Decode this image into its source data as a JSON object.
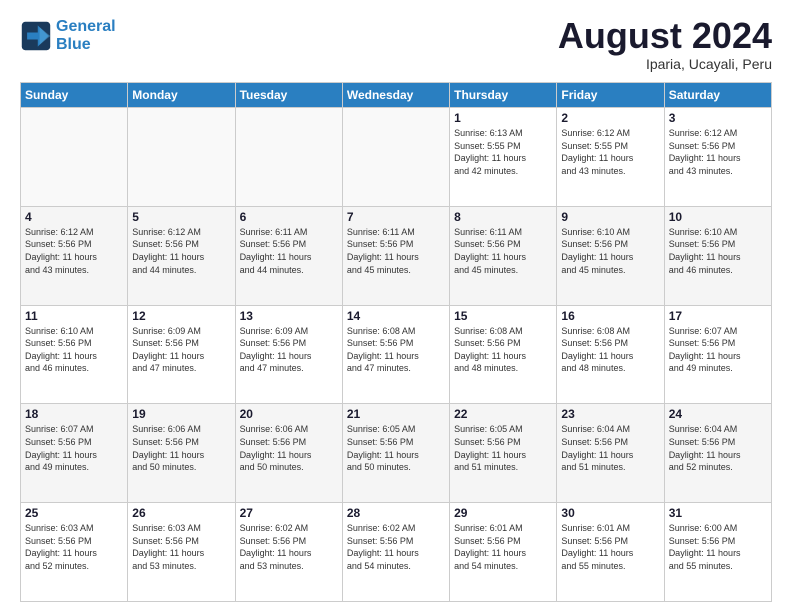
{
  "logo": {
    "line1": "General",
    "line2": "Blue"
  },
  "title": "August 2024",
  "subtitle": "Iparia, Ucayali, Peru",
  "weekdays": [
    "Sunday",
    "Monday",
    "Tuesday",
    "Wednesday",
    "Thursday",
    "Friday",
    "Saturday"
  ],
  "weeks": [
    [
      {
        "day": "",
        "empty": true
      },
      {
        "day": "",
        "empty": true
      },
      {
        "day": "",
        "empty": true
      },
      {
        "day": "",
        "empty": true
      },
      {
        "day": "1",
        "sunrise": "6:13 AM",
        "sunset": "5:55 PM",
        "daylight": "11 hours and 42 minutes."
      },
      {
        "day": "2",
        "sunrise": "6:12 AM",
        "sunset": "5:55 PM",
        "daylight": "11 hours and 43 minutes."
      },
      {
        "day": "3",
        "sunrise": "6:12 AM",
        "sunset": "5:56 PM",
        "daylight": "11 hours and 43 minutes."
      }
    ],
    [
      {
        "day": "4",
        "sunrise": "6:12 AM",
        "sunset": "5:56 PM",
        "daylight": "11 hours and 43 minutes."
      },
      {
        "day": "5",
        "sunrise": "6:12 AM",
        "sunset": "5:56 PM",
        "daylight": "11 hours and 44 minutes."
      },
      {
        "day": "6",
        "sunrise": "6:11 AM",
        "sunset": "5:56 PM",
        "daylight": "11 hours and 44 minutes."
      },
      {
        "day": "7",
        "sunrise": "6:11 AM",
        "sunset": "5:56 PM",
        "daylight": "11 hours and 45 minutes."
      },
      {
        "day": "8",
        "sunrise": "6:11 AM",
        "sunset": "5:56 PM",
        "daylight": "11 hours and 45 minutes."
      },
      {
        "day": "9",
        "sunrise": "6:10 AM",
        "sunset": "5:56 PM",
        "daylight": "11 hours and 45 minutes."
      },
      {
        "day": "10",
        "sunrise": "6:10 AM",
        "sunset": "5:56 PM",
        "daylight": "11 hours and 46 minutes."
      }
    ],
    [
      {
        "day": "11",
        "sunrise": "6:10 AM",
        "sunset": "5:56 PM",
        "daylight": "11 hours and 46 minutes."
      },
      {
        "day": "12",
        "sunrise": "6:09 AM",
        "sunset": "5:56 PM",
        "daylight": "11 hours and 47 minutes."
      },
      {
        "day": "13",
        "sunrise": "6:09 AM",
        "sunset": "5:56 PM",
        "daylight": "11 hours and 47 minutes."
      },
      {
        "day": "14",
        "sunrise": "6:08 AM",
        "sunset": "5:56 PM",
        "daylight": "11 hours and 47 minutes."
      },
      {
        "day": "15",
        "sunrise": "6:08 AM",
        "sunset": "5:56 PM",
        "daylight": "11 hours and 48 minutes."
      },
      {
        "day": "16",
        "sunrise": "6:08 AM",
        "sunset": "5:56 PM",
        "daylight": "11 hours and 48 minutes."
      },
      {
        "day": "17",
        "sunrise": "6:07 AM",
        "sunset": "5:56 PM",
        "daylight": "11 hours and 49 minutes."
      }
    ],
    [
      {
        "day": "18",
        "sunrise": "6:07 AM",
        "sunset": "5:56 PM",
        "daylight": "11 hours and 49 minutes."
      },
      {
        "day": "19",
        "sunrise": "6:06 AM",
        "sunset": "5:56 PM",
        "daylight": "11 hours and 50 minutes."
      },
      {
        "day": "20",
        "sunrise": "6:06 AM",
        "sunset": "5:56 PM",
        "daylight": "11 hours and 50 minutes."
      },
      {
        "day": "21",
        "sunrise": "6:05 AM",
        "sunset": "5:56 PM",
        "daylight": "11 hours and 50 minutes."
      },
      {
        "day": "22",
        "sunrise": "6:05 AM",
        "sunset": "5:56 PM",
        "daylight": "11 hours and 51 minutes."
      },
      {
        "day": "23",
        "sunrise": "6:04 AM",
        "sunset": "5:56 PM",
        "daylight": "11 hours and 51 minutes."
      },
      {
        "day": "24",
        "sunrise": "6:04 AM",
        "sunset": "5:56 PM",
        "daylight": "11 hours and 52 minutes."
      }
    ],
    [
      {
        "day": "25",
        "sunrise": "6:03 AM",
        "sunset": "5:56 PM",
        "daylight": "11 hours and 52 minutes."
      },
      {
        "day": "26",
        "sunrise": "6:03 AM",
        "sunset": "5:56 PM",
        "daylight": "11 hours and 53 minutes."
      },
      {
        "day": "27",
        "sunrise": "6:02 AM",
        "sunset": "5:56 PM",
        "daylight": "11 hours and 53 minutes."
      },
      {
        "day": "28",
        "sunrise": "6:02 AM",
        "sunset": "5:56 PM",
        "daylight": "11 hours and 54 minutes."
      },
      {
        "day": "29",
        "sunrise": "6:01 AM",
        "sunset": "5:56 PM",
        "daylight": "11 hours and 54 minutes."
      },
      {
        "day": "30",
        "sunrise": "6:01 AM",
        "sunset": "5:56 PM",
        "daylight": "11 hours and 55 minutes."
      },
      {
        "day": "31",
        "sunrise": "6:00 AM",
        "sunset": "5:56 PM",
        "daylight": "11 hours and 55 minutes."
      }
    ]
  ]
}
